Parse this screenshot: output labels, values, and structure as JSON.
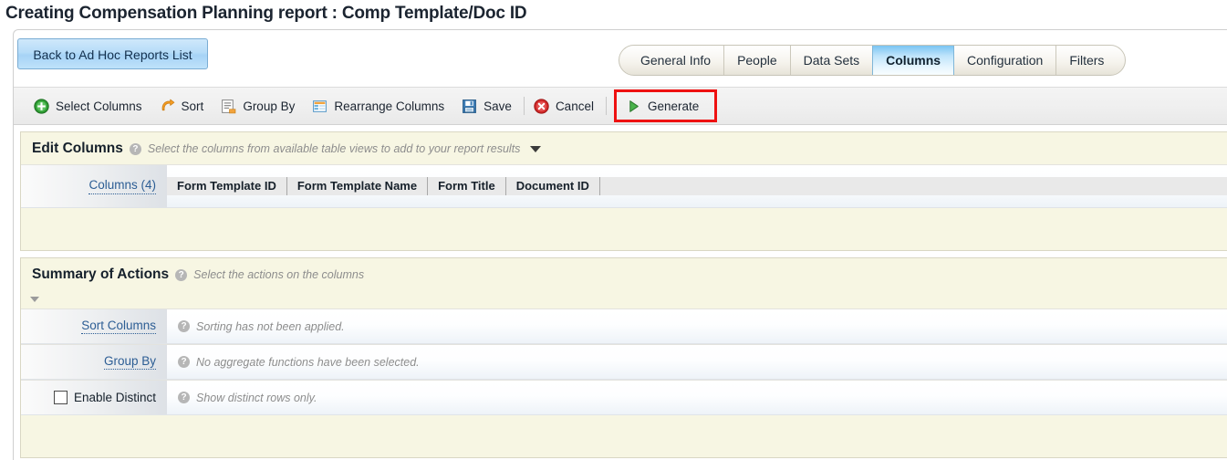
{
  "page": {
    "title": "Creating Compensation Planning report : Comp Template/Doc ID"
  },
  "header": {
    "back_button": "Back to Ad Hoc Reports List",
    "tabs": [
      {
        "label": "General Info",
        "active": false
      },
      {
        "label": "People",
        "active": false
      },
      {
        "label": "Data Sets",
        "active": false
      },
      {
        "label": "Columns",
        "active": true
      },
      {
        "label": "Configuration",
        "active": false
      },
      {
        "label": "Filters",
        "active": false
      }
    ]
  },
  "toolbar": {
    "items": [
      {
        "label": "Select Columns",
        "icon": "green-plus-circle-icon"
      },
      {
        "label": "Sort",
        "icon": "orange-sort-arrow-icon"
      },
      {
        "label": "Group By",
        "icon": "group-by-list-icon"
      },
      {
        "label": "Rearrange Columns",
        "icon": "rearrange-columns-grid-icon"
      },
      {
        "label": "Save",
        "icon": "floppy-disk-icon"
      },
      {
        "label": "Cancel",
        "icon": "red-x-circle-icon"
      }
    ],
    "generate": {
      "label": "Generate",
      "icon": "green-play-triangle-icon"
    },
    "highlight_color": "#ee1111"
  },
  "edit_columns": {
    "title": "Edit Columns",
    "hint": "Select the columns from available table views to add to your report results",
    "row_label": "Columns (4)",
    "columns": [
      "Form Template ID",
      "Form Template Name",
      "Form Title",
      "Document ID"
    ]
  },
  "summary_of_actions": {
    "title": "Summary of Actions",
    "hint": "Select the actions on the columns",
    "rows": [
      {
        "label": "Sort Columns",
        "type": "link",
        "hint": "Sorting has not been applied."
      },
      {
        "label": "Group By",
        "type": "link",
        "hint": "No aggregate functions have been selected."
      },
      {
        "label": "Enable Distinct",
        "type": "checkbox",
        "checked": false,
        "hint": "Show distinct rows only."
      }
    ]
  },
  "colors": {
    "panel_background": "#f7f6e3",
    "active_tab": "#79c4f2",
    "link": "#2c5d94",
    "highlight": "#ee1111"
  }
}
